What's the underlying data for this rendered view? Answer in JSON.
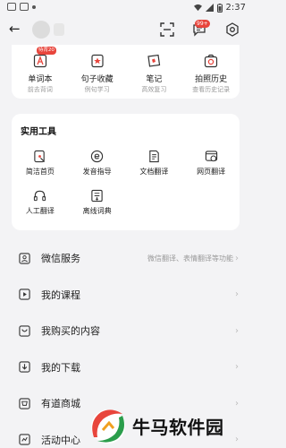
{
  "status_bar": {
    "time": "2:37"
  },
  "top_nav": {
    "message_badge": "99+"
  },
  "quick_access": [
    {
      "label": "单词本",
      "sub": "前去背词",
      "badge": "待背20",
      "icon": "wordbook-icon"
    },
    {
      "label": "句子收藏",
      "sub": "例句学习",
      "icon": "sentence-collect-icon"
    },
    {
      "label": "笔记",
      "sub": "高效复习",
      "icon": "notes-icon"
    },
    {
      "label": "拍照历史",
      "sub": "查看历史记录",
      "icon": "photo-history-icon"
    }
  ],
  "tools": {
    "title": "实用工具",
    "items": [
      {
        "label": "简洁首页",
        "icon": "simple-home-icon"
      },
      {
        "label": "发音指导",
        "icon": "pronunciation-icon"
      },
      {
        "label": "文档翻译",
        "icon": "document-translate-icon"
      },
      {
        "label": "网页翻译",
        "icon": "web-translate-icon"
      },
      {
        "label": "人工翻译",
        "icon": "human-translate-icon"
      },
      {
        "label": "离线词典",
        "icon": "offline-dictionary-icon"
      }
    ]
  },
  "menu": [
    {
      "label": "微信服务",
      "sub": "微信翻译、表情翻译等功能",
      "icon": "wechat-service-icon"
    },
    {
      "label": "我的课程",
      "sub": "",
      "icon": "course-icon"
    },
    {
      "label": "我购买的内容",
      "sub": "",
      "icon": "purchase-icon"
    },
    {
      "label": "我的下载",
      "sub": "",
      "icon": "download-icon"
    },
    {
      "label": "有道商城",
      "sub": "",
      "icon": "store-icon"
    },
    {
      "label": "活动中心",
      "sub": "",
      "icon": "activity-icon"
    }
  ],
  "watermark": {
    "text": "牛马软件园"
  },
  "colors": {
    "accent": "#e8453c",
    "background": "#f3f3f5",
    "card": "#ffffff"
  }
}
